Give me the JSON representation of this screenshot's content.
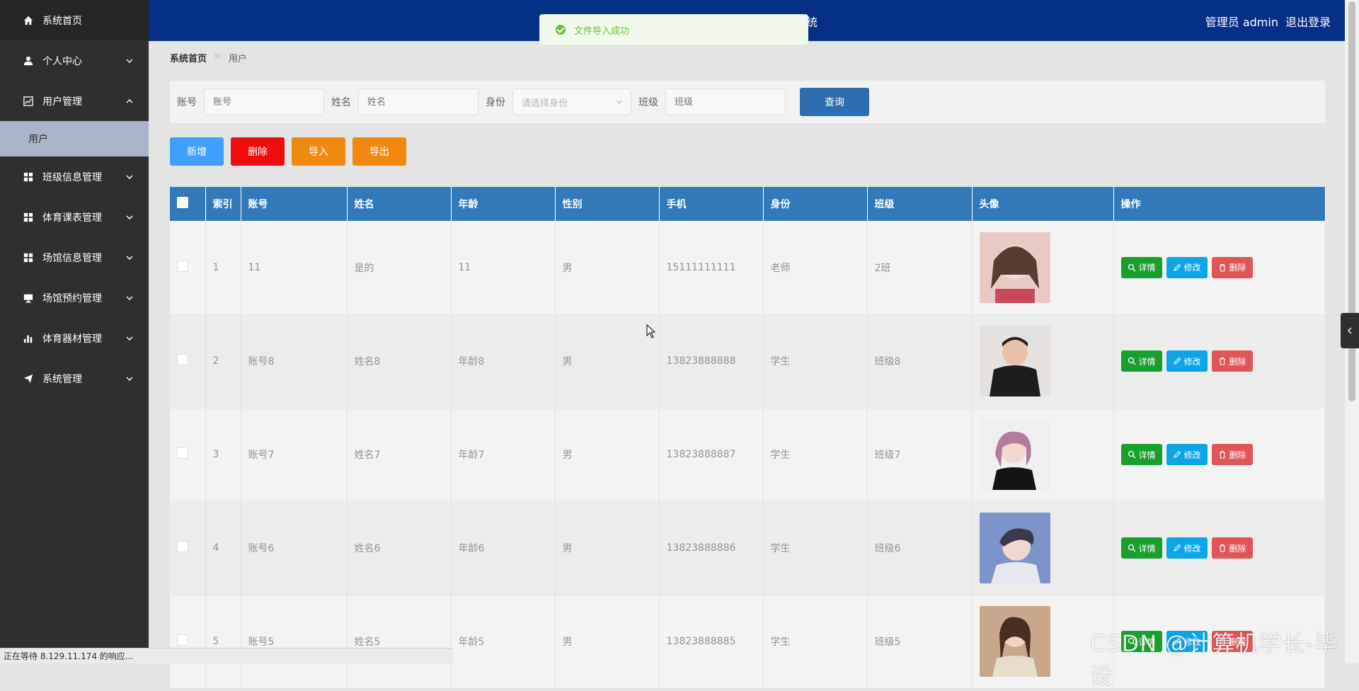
{
  "sidebar": {
    "items": [
      {
        "label": "系统首页",
        "icon": "home-icon",
        "expanded": null
      },
      {
        "label": "个人中心",
        "icon": "user-icon",
        "expanded": false
      },
      {
        "label": "用户管理",
        "icon": "chart-icon",
        "expanded": true,
        "sub": [
          {
            "label": "用户"
          }
        ]
      },
      {
        "label": "班级信息管理",
        "icon": "grid-icon",
        "expanded": false
      },
      {
        "label": "体育课表管理",
        "icon": "grid-icon",
        "expanded": false
      },
      {
        "label": "场馆信息管理",
        "icon": "grid-icon",
        "expanded": false
      },
      {
        "label": "场馆预约管理",
        "icon": "monitor-icon",
        "expanded": false
      },
      {
        "label": "体育器材管理",
        "icon": "bar-chart-icon",
        "expanded": false
      },
      {
        "label": "系统管理",
        "icon": "paper-plane-icon",
        "expanded": false
      }
    ]
  },
  "header": {
    "title_fragment": "统",
    "user_label": "管理员 admin",
    "logout_label": "退出登录"
  },
  "toast": {
    "message": "文件导入成功"
  },
  "breadcrumb": {
    "home": "系统首页",
    "current": "用户"
  },
  "search": {
    "account_label": "账号",
    "account_placeholder": "账号",
    "name_label": "姓名",
    "name_placeholder": "姓名",
    "role_label": "身份",
    "role_placeholder": "请选择身份",
    "class_label": "班级",
    "class_placeholder": "班级",
    "query_label": "查询"
  },
  "actions": {
    "add": "新增",
    "delete": "删除",
    "import": "导入",
    "export": "导出"
  },
  "table": {
    "headers": {
      "index": "索引",
      "account": "账号",
      "name": "姓名",
      "age": "年龄",
      "gender": "性别",
      "phone": "手机",
      "role": "身份",
      "class": "班级",
      "avatar": "头像",
      "ops": "操作"
    },
    "op_labels": {
      "detail": "详情",
      "edit": "修改",
      "remove": "删除"
    },
    "rows": [
      {
        "index": "1",
        "account": "11",
        "name": "是的",
        "age": "11",
        "gender": "男",
        "phone": "15111111111",
        "role": "老师",
        "class": "2班"
      },
      {
        "index": "2",
        "account": "账号8",
        "name": "姓名8",
        "age": "年龄8",
        "gender": "男",
        "phone": "13823888888",
        "role": "学生",
        "class": "班级8"
      },
      {
        "index": "3",
        "account": "账号7",
        "name": "姓名7",
        "age": "年龄7",
        "gender": "男",
        "phone": "13823888887",
        "role": "学生",
        "class": "班级7"
      },
      {
        "index": "4",
        "account": "账号6",
        "name": "姓名6",
        "age": "年龄6",
        "gender": "男",
        "phone": "13823888886",
        "role": "学生",
        "class": "班级6"
      },
      {
        "index": "5",
        "account": "账号5",
        "name": "姓名5",
        "age": "年龄5",
        "gender": "男",
        "phone": "13823888885",
        "role": "学生",
        "class": "班级5"
      }
    ]
  },
  "status_bar": {
    "text": "正在等待 8.129.11.174 的响应..."
  },
  "watermark": {
    "text": "CSDN @计算机学长-毕设"
  },
  "colors": {
    "sidebar": "#2f2f2f",
    "header": "#062f86",
    "table_header": "#3479b7",
    "submenu_active": "#a9b4cc"
  }
}
